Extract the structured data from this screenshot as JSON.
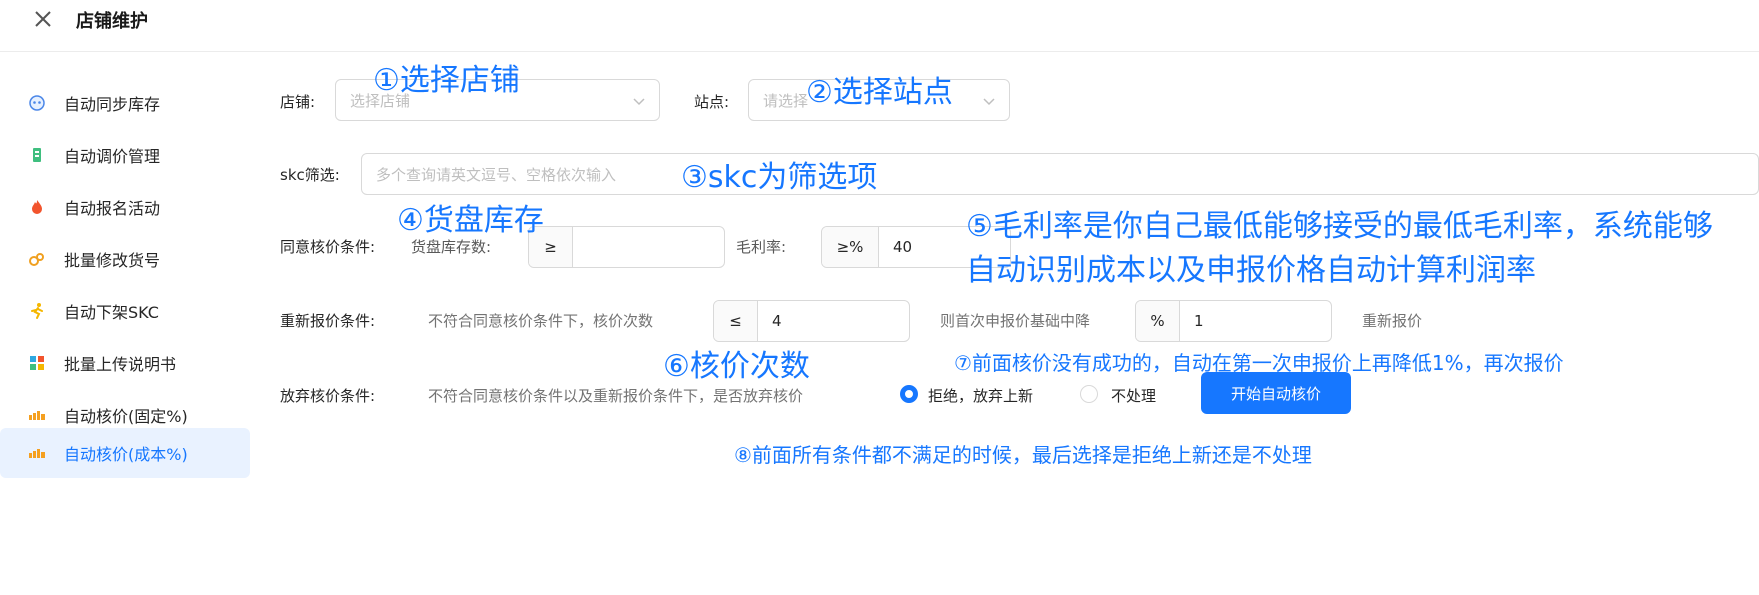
{
  "header": {
    "title": "店铺维护"
  },
  "sidebar": {
    "items": [
      {
        "label": "自动同步库存",
        "icon": "robot-icon"
      },
      {
        "label": "自动调价管理",
        "icon": "price-tag-icon"
      },
      {
        "label": "自动报名活动",
        "icon": "flame-icon"
      },
      {
        "label": "批量修改货号",
        "icon": "gears-icon"
      },
      {
        "label": "自动下架SKC",
        "icon": "runner-icon"
      },
      {
        "label": "批量上传说明书",
        "icon": "puzzle-icon"
      },
      {
        "label": "自动核价(固定%)",
        "icon": "bars-icon"
      },
      {
        "label": "自动核价(成本%)",
        "icon": "bars-icon"
      }
    ],
    "active_index": 7
  },
  "form": {
    "store_label": "店铺:",
    "store_placeholder": "选择店铺",
    "site_label": "站点:",
    "site_placeholder": "请选择",
    "skc_label": "skc筛选:",
    "skc_placeholder": "多个查询请英文逗号、空格依次输入",
    "agree_label": "同意核价条件:",
    "stock_label": "货盘库存数:",
    "stock_op": "≥",
    "stock_value": "",
    "margin_label": "毛利率:",
    "margin_op": "≥%",
    "margin_value": "40",
    "requote_label": "重新报价条件:",
    "requote_desc": "不符合同意核价条件下，核价次数",
    "count_op": "≤",
    "count_value": "4",
    "reduce_label": "则首次申报价基础中降",
    "reduce_op": "%",
    "reduce_value": "1",
    "requote_suffix": "重新报价",
    "abandon_label": "放弃核价条件:",
    "abandon_desc": "不符合同意核价条件以及重新报价条件下，是否放弃核价",
    "radio_reject": "拒绝，放弃上新",
    "radio_ignore": "不处理",
    "start_button": "开始自动核价"
  },
  "annotations": {
    "a1": "①选择店铺",
    "a2": "②选择站点",
    "a3": "③skc为筛选项",
    "a4": "④货盘库存",
    "a5_line1": "⑤毛利率是你自己最低能够接受的最低毛利率，系统能够",
    "a5_line2": "自动识别成本以及申报价格自动计算利润率",
    "a6": "⑥核价次数",
    "a7": "⑦前面核价没有成功的，自动在第一次申报价上再降低1%，再次报价",
    "a8": "⑧前面所有条件都不满足的时候，最后选择是拒绝上新还是不处理"
  },
  "colors": {
    "primary": "#1677ff",
    "active_bg": "#e9f2ff"
  }
}
